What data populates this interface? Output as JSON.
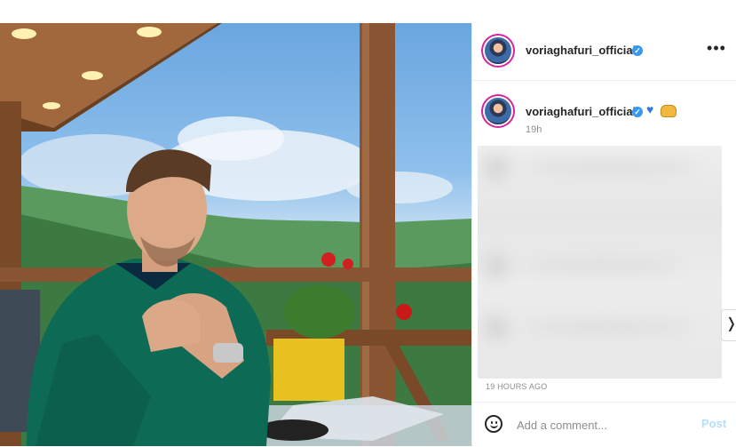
{
  "post": {
    "author": "voriaghafuri_official",
    "more_icon_glyph": "•••",
    "caption": {
      "author": "voriaghafuri_official",
      "emojis": [
        "blue-heart",
        "raised-hands"
      ],
      "time_short": "19h"
    },
    "time_full": "19 HOURS AGO",
    "comment": {
      "placeholder": "Add a comment...",
      "post_label": "Post"
    },
    "colors": {
      "verified": "#3897f0",
      "post_button": "#b2dffc",
      "story_ring": "#d6249f"
    }
  }
}
